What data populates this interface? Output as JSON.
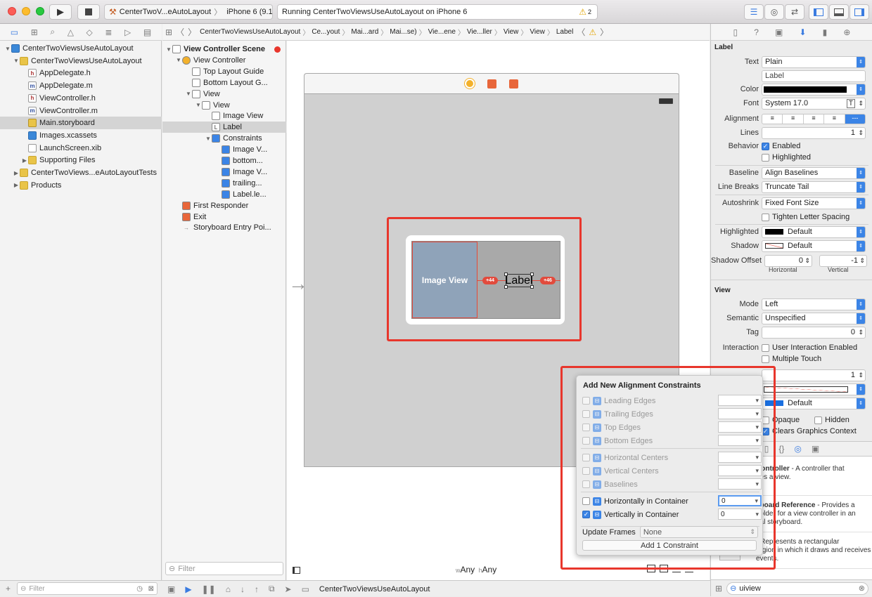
{
  "toolbar": {
    "scheme": "CenterTwoV...eAutoLayout",
    "device": "iPhone 6 (9.1)",
    "status": "Running CenterTwoViewsUseAutoLayout on iPhone 6",
    "warning_count": "2"
  },
  "jumpbar": [
    "CenterTwoViewsUseAutoLayout",
    "Ce...yout",
    "Mai...ard",
    "Mai...se)",
    "Vie...ene",
    "Vie...ller",
    "View",
    "View",
    "Label"
  ],
  "navigator": {
    "items": [
      {
        "label": "CenterTwoViewsUseAutoLayout",
        "indent": 0,
        "icon": "project",
        "open": true
      },
      {
        "label": "CenterTwoViewsUseAutoLayout",
        "indent": 1,
        "icon": "folder",
        "open": true
      },
      {
        "label": "AppDelegate.h",
        "indent": 2,
        "icon": "h"
      },
      {
        "label": "AppDelegate.m",
        "indent": 2,
        "icon": "m"
      },
      {
        "label": "ViewController.h",
        "indent": 2,
        "icon": "h"
      },
      {
        "label": "ViewController.m",
        "indent": 2,
        "icon": "m"
      },
      {
        "label": "Main.storyboard",
        "indent": 2,
        "icon": "sb",
        "selected": true
      },
      {
        "label": "Images.xcassets",
        "indent": 2,
        "icon": "xc"
      },
      {
        "label": "LaunchScreen.xib",
        "indent": 2,
        "icon": "xib"
      },
      {
        "label": "Supporting Files",
        "indent": 2,
        "icon": "folder",
        "closed": true
      },
      {
        "label": "CenterTwoViews...eAutoLayoutTests",
        "indent": 1,
        "icon": "folder",
        "closed": true
      },
      {
        "label": "Products",
        "indent": 1,
        "icon": "folder",
        "closed": true
      }
    ],
    "filter_placeholder": "Filter"
  },
  "outline": {
    "items": [
      {
        "label": "View Controller Scene",
        "indent": 0,
        "bold": true,
        "open": true
      },
      {
        "label": "View Controller",
        "indent": 1,
        "open": true,
        "icon": "vc"
      },
      {
        "label": "Top Layout Guide",
        "indent": 2,
        "icon": "box"
      },
      {
        "label": "Bottom Layout G...",
        "indent": 2,
        "icon": "box"
      },
      {
        "label": "View",
        "indent": 2,
        "open": true,
        "icon": "box"
      },
      {
        "label": "View",
        "indent": 3,
        "open": true,
        "icon": "box"
      },
      {
        "label": "Image View",
        "indent": 4,
        "icon": "img"
      },
      {
        "label": "Label",
        "indent": 4,
        "icon": "L",
        "selected": true
      },
      {
        "label": "Constraints",
        "indent": 4,
        "open": true,
        "icon": "con"
      },
      {
        "label": "Image V...",
        "indent": 5,
        "icon": "con"
      },
      {
        "label": "bottom...",
        "indent": 5,
        "icon": "con"
      },
      {
        "label": "Image V...",
        "indent": 5,
        "icon": "con"
      },
      {
        "label": "trailing...",
        "indent": 5,
        "icon": "con"
      },
      {
        "label": "Label.le...",
        "indent": 5,
        "icon": "con"
      },
      {
        "label": "First Responder",
        "indent": 1,
        "icon": "fr"
      },
      {
        "label": "Exit",
        "indent": 1,
        "icon": "exit"
      },
      {
        "label": "Storyboard Entry Poi...",
        "indent": 1,
        "icon": "arrow"
      }
    ],
    "filter_placeholder": "Filter"
  },
  "canvas": {
    "image_view_label": "Image View",
    "label_text": "Label",
    "leading_badge": "+44",
    "trailing_badge": "+46",
    "size_class_w": "w",
    "size_class_w_value": "Any",
    "size_class_h": "h",
    "size_class_h_value": "Any"
  },
  "popover": {
    "title": "Add New Alignment Constraints",
    "rows": [
      {
        "label": "Leading Edges",
        "checked": false,
        "enabled": false,
        "value": ""
      },
      {
        "label": "Trailing Edges",
        "checked": false,
        "enabled": false,
        "value": ""
      },
      {
        "label": "Top Edges",
        "checked": false,
        "enabled": false,
        "value": ""
      },
      {
        "label": "Bottom Edges",
        "checked": false,
        "enabled": false,
        "value": ""
      },
      {
        "label": "Horizontal Centers",
        "checked": false,
        "enabled": false,
        "value": ""
      },
      {
        "label": "Vertical Centers",
        "checked": false,
        "enabled": false,
        "value": ""
      },
      {
        "label": "Baselines",
        "checked": false,
        "enabled": false,
        "value": ""
      },
      {
        "label": "Horizontally in Container",
        "checked": false,
        "enabled": true,
        "value": "0"
      },
      {
        "label": "Vertically in Container",
        "checked": true,
        "enabled": true,
        "value": "0"
      }
    ],
    "update_frames_label": "Update Frames",
    "update_frames_value": "None",
    "add_button": "Add 1 Constraint"
  },
  "inspector": {
    "label_section": "Label",
    "text_label": "Text",
    "text_value": "Plain",
    "text_content": "Label",
    "color_label": "Color",
    "font_label": "Font",
    "font_value": "System 17.0",
    "alignment_label": "Alignment",
    "lines_label": "Lines",
    "lines_value": "1",
    "behavior_label": "Behavior",
    "enabled_label": "Enabled",
    "highlighted_label": "Highlighted",
    "baseline_label": "Baseline",
    "baseline_value": "Align Baselines",
    "linebreaks_label": "Line Breaks",
    "linebreaks_value": "Truncate Tail",
    "autoshrink_label": "Autoshrink",
    "autoshrink_value": "Fixed Font Size",
    "tighten_label": "Tighten Letter Spacing",
    "highlighted_color_label": "Highlighted",
    "highlighted_color_value": "Default",
    "shadow_label": "Shadow",
    "shadow_value": "Default",
    "shadow_offset_label": "Shadow Offset",
    "shadow_h": "0",
    "shadow_v": "-1",
    "horizontal_label": "Horizontal",
    "vertical_label": "Vertical",
    "view_section": "View",
    "mode_label": "Mode",
    "mode_value": "Left",
    "semantic_label": "Semantic",
    "semantic_value": "Unspecified",
    "tag_label": "Tag",
    "tag_value": "0",
    "interaction_label": "Interaction",
    "user_interaction": "User Interaction Enabled",
    "multiple_touch": "Multiple Touch",
    "alpha_value": "1",
    "tint_value": "Default",
    "opaque_label": "Opaque",
    "hidden_label": "Hidden",
    "clears_label": "Clears Graphics Context",
    "library": [
      {
        "title": "Controller",
        "desc": " - A controller that",
        "desc2": "ges a view."
      },
      {
        "title": "yboard Reference",
        "desc": " - Provides a",
        "desc2": "holder for a view controller in an",
        "desc3": "nal storyboard."
      },
      {
        "title": "",
        "desc": "- Represents a rectangular",
        "desc2": "region in which it draws and receives",
        "desc3": "events."
      }
    ],
    "search_value": "uiview"
  },
  "bottombar": {
    "target": "CenterTwoViewsUseAutoLayout"
  }
}
